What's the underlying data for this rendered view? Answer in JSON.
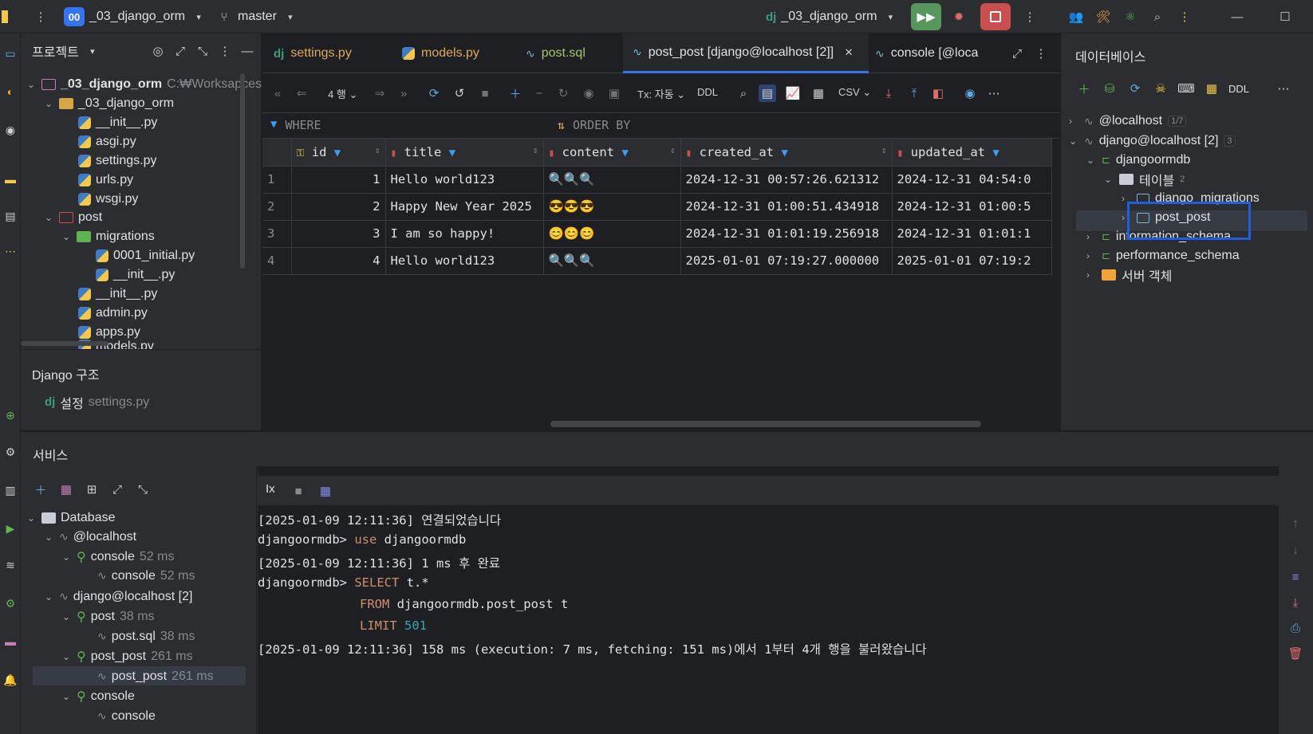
{
  "titlebar": {
    "project_badge": "00",
    "project_name": "_03_django_orm",
    "branch": "master",
    "run_config": "_03_django_orm"
  },
  "project_panel": {
    "title": "프로젝트",
    "tree": [
      {
        "label": "_03_django_orm",
        "extra": "C:₩Worksapces",
        "type": "root"
      },
      {
        "label": "_03_django_orm",
        "type": "folder"
      },
      {
        "label": "__init__.py",
        "type": "py"
      },
      {
        "label": "asgi.py",
        "type": "py"
      },
      {
        "label": "settings.py",
        "type": "py"
      },
      {
        "label": "urls.py",
        "type": "py"
      },
      {
        "label": "wsgi.py",
        "type": "py"
      },
      {
        "label": "post",
        "type": "app"
      },
      {
        "label": "migrations",
        "type": "folder-green"
      },
      {
        "label": "0001_initial.py",
        "type": "py"
      },
      {
        "label": "__init__.py",
        "type": "py"
      },
      {
        "label": "__init__.py",
        "type": "py"
      },
      {
        "label": "admin.py",
        "type": "py"
      },
      {
        "label": "apps.py",
        "type": "py"
      },
      {
        "label": "models.py",
        "type": "py"
      }
    ],
    "django_section": "Django 구조",
    "django_setting_label": "설정",
    "django_setting_file": "settings.py"
  },
  "tabs": [
    {
      "label": "settings.py",
      "icon": "django-icon"
    },
    {
      "label": "models.py",
      "icon": "python-icon"
    },
    {
      "label": "post.sql",
      "icon": "sql-icon"
    },
    {
      "label": "post_post [django@localhost [2]]",
      "icon": "sql-icon",
      "active": true
    },
    {
      "label": "console [@loca",
      "icon": "sql-icon"
    }
  ],
  "grid_toolbar": {
    "rows": "4 행",
    "tx": "Tx: 자동",
    "ddl": "DDL",
    "csv": "CSV"
  },
  "filter": {
    "where": "WHERE",
    "order_by": "ORDER BY"
  },
  "table": {
    "columns": [
      "id",
      "title",
      "content",
      "created_at",
      "updated_at"
    ],
    "rows": [
      {
        "n": "1",
        "id": "1",
        "title": "Hello world123",
        "content": "🔍🔍🔍",
        "created_at": "2024-12-31 00:57:26.621312",
        "updated_at": "2024-12-31 04:54:0"
      },
      {
        "n": "2",
        "id": "2",
        "title": "Happy New Year 2025",
        "content": "😎😎😎",
        "created_at": "2024-12-31 01:00:51.434918",
        "updated_at": "2024-12-31 01:00:5"
      },
      {
        "n": "3",
        "id": "3",
        "title": "I am so happy!",
        "content": "😊😊😊",
        "created_at": "2024-12-31 01:01:19.256918",
        "updated_at": "2024-12-31 01:01:1"
      },
      {
        "n": "4",
        "id": "4",
        "title": "Hello world123",
        "content": "🔍🔍🔍",
        "created_at": "2025-01-01 07:19:27.000000",
        "updated_at": "2025-01-01 07:19:2"
      }
    ]
  },
  "db_panel": {
    "title": "데이터베이스",
    "ddl": "DDL",
    "localhost": "@localhost",
    "localhost_count": "1/7",
    "django_conn": "django@localhost [2]",
    "django_conn_count": "3",
    "schema": "djangoormdb",
    "tables_label": "테이블",
    "tables_count": "2",
    "table1": "django_migrations",
    "table2": "post_post",
    "info_schema": "information_schema",
    "perf_schema": "performance_schema",
    "server_objects": "서버 객체"
  },
  "services": {
    "title": "서비스",
    "tree": [
      {
        "label": "Database"
      },
      {
        "label": "@localhost"
      },
      {
        "label": "console",
        "time": "52 ms"
      },
      {
        "label": "console",
        "time": "52 ms"
      },
      {
        "label": "django@localhost [2]"
      },
      {
        "label": "post",
        "time": "38 ms"
      },
      {
        "label": "post.sql",
        "time": "38 ms"
      },
      {
        "label": "post_post",
        "time": "261 ms"
      },
      {
        "label": "post_post",
        "time": "261 ms"
      },
      {
        "label": "console"
      },
      {
        "label": "console"
      }
    ],
    "console_tool_tx": "Ix"
  },
  "console": {
    "l1": "[2025-01-09 12:11:36] 연결되었습니다",
    "l2a": "djangoormdb> ",
    "l2b": "use",
    "l2c": " djangoormdb",
    "l3": "[2025-01-09 12:11:36] 1 ms 후 완료",
    "l4a": "djangoormdb> ",
    "l4b": "SELECT",
    "l4c": " t.*",
    "l5a": "FROM",
    "l5b": " djangoormdb.post_post t",
    "l6a": "LIMIT",
    "l6b": "501",
    "l7": "[2025-01-09 12:11:36] 158 ms (execution: 7 ms, fetching: 151 ms)에서 1부터 4개 행을 불러왔습니다"
  }
}
